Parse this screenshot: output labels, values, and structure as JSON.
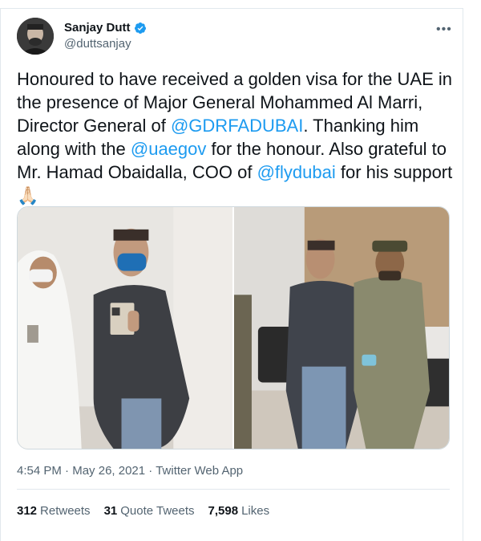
{
  "tweet": {
    "author": {
      "display_name": "Sanjay Dutt",
      "handle": "@duttsanjay",
      "verified": true,
      "avatar_icon": "profile-photo-icon"
    },
    "more_label": "•••",
    "text_parts": {
      "p1": "Honoured to have received a golden visa for the UAE in the presence of Major General Mohammed Al Marri, Director General of ",
      "m1": "@GDRFADUBAI",
      "p2": ". Thanking him along with the ",
      "m2": "@uaegov",
      "p3": " for the honour. Also grateful to Mr. Hamad Obaidalla, COO of ",
      "m3": "@flydubai",
      "p4": " for his support",
      "emoji": "🙏🏻"
    },
    "media": [
      {
        "icon": "photo-icon",
        "description_name": "passport-presentation-photo"
      },
      {
        "icon": "photo-icon",
        "description_name": "office-standing-photo"
      }
    ],
    "meta": {
      "time": "4:54 PM",
      "separator1": " · ",
      "date": "May 26, 2021",
      "separator2": " · ",
      "app": "Twitter Web App"
    },
    "stats": [
      {
        "count": "312",
        "label": "Retweets"
      },
      {
        "count": "31",
        "label": "Quote Tweets"
      },
      {
        "count": "7,598",
        "label": "Likes"
      }
    ]
  },
  "colors": {
    "accent": "#1d9bf0",
    "text": "#0f1419",
    "secondary": "#536471",
    "border": "#e1e8ed"
  }
}
